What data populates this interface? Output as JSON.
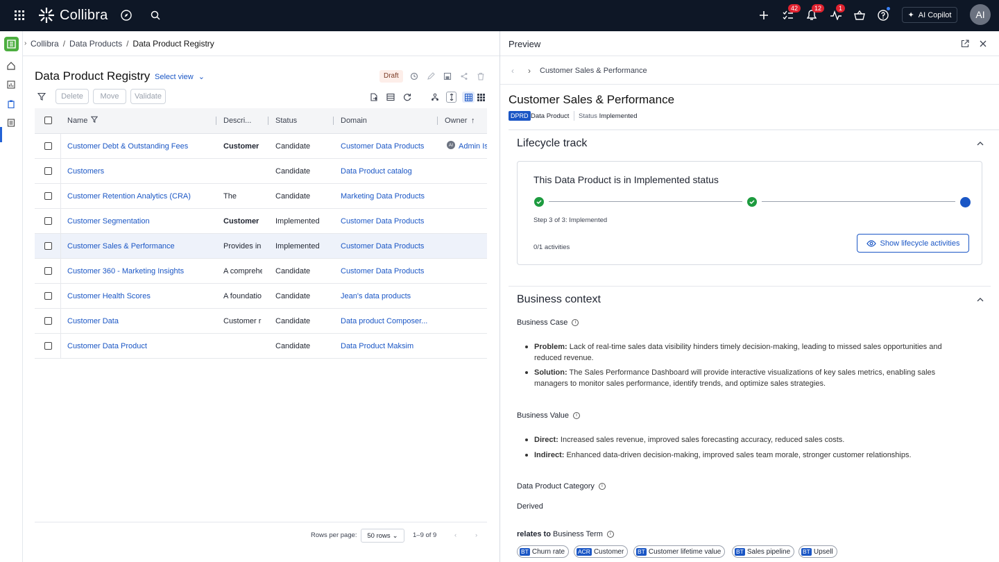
{
  "app": {
    "name": "Collibra"
  },
  "topbar": {
    "badges": {
      "tasks": "42",
      "notifications": "12",
      "activity": "1"
    },
    "copilot_label": "AI Copilot",
    "avatar_initials": "AI"
  },
  "breadcrumb": {
    "items": [
      "Collibra",
      "Data Products",
      "Data Product Registry"
    ],
    "separator": "/"
  },
  "registry": {
    "title": "Data Product Registry",
    "select_view": "Select view",
    "draft_label": "Draft",
    "actions": {
      "delete": "Delete",
      "move": "Move",
      "validate": "Validate"
    },
    "columns": {
      "name": "Name",
      "description": "Descri...",
      "status": "Status",
      "domain": "Domain",
      "owner": "Owner"
    },
    "rows": [
      {
        "name": "Customer Debt & Outstanding Fees",
        "description": "Customer",
        "desc_bold": true,
        "status": "Candidate",
        "domain": "Customer Data Products",
        "owner_initials": "AI",
        "owner": "Admin Is"
      },
      {
        "name": "Customers",
        "description": "",
        "status": "Candidate",
        "domain": "Data Product catalog",
        "owner": ""
      },
      {
        "name": "Customer Retention Analytics (CRA)",
        "description": "The",
        "status": "Candidate",
        "domain": "Marketing Data Products",
        "owner": ""
      },
      {
        "name": "Customer Segmentation",
        "description": "Customer",
        "desc_bold": true,
        "status": "Implemented",
        "domain": "Customer Data Products",
        "owner": ""
      },
      {
        "name": "Customer Sales & Performance",
        "description": "Provides in",
        "status": "Implemented",
        "domain": "Customer Data Products",
        "owner": "",
        "selected": true
      },
      {
        "name": "Customer 360 - Marketing Insights",
        "description": "A comprehe",
        "status": "Candidate",
        "domain": "Customer Data Products",
        "owner": ""
      },
      {
        "name": "Customer Health Scores",
        "description": "A foundatio",
        "status": "Candidate",
        "domain": "Jean's data products",
        "owner": ""
      },
      {
        "name": "Customer Data",
        "description": "Customer r",
        "status": "Candidate",
        "domain": "Data product Composer...",
        "owner": ""
      },
      {
        "name": "Customer Data Product",
        "description": "",
        "status": "Candidate",
        "domain": "Data Product Maksim",
        "owner": ""
      }
    ],
    "footer": {
      "rows_per_page_label": "Rows per page:",
      "rows_per_page_value": "50 rows",
      "range": "1–9 of 9"
    }
  },
  "preview": {
    "header": "Preview",
    "crumb": "Customer Sales & Performance",
    "name": "Customer Sales & Performance",
    "type_tag": "DPRD",
    "type_label": "Data Product",
    "status_label": "Status",
    "status_value": "Implemented",
    "lifecycle": {
      "section_title": "Lifecycle track",
      "headline": "This Data Product is in Implemented status",
      "step_text": "Step 3 of 3: Implemented",
      "activities": "0/1 activities",
      "button": "Show lifecycle activities",
      "current_step": 3,
      "total_steps": 3
    },
    "business_context": {
      "section_title": "Business context",
      "business_case_label": "Business Case",
      "business_case": [
        {
          "lead": "Problem:",
          "text": "Lack of real-time sales data visibility hinders timely decision-making, leading to missed sales opportunities and reduced revenue."
        },
        {
          "lead": "Solution:",
          "text": "The Sales Performance Dashboard will provide interactive visualizations of key sales metrics, enabling sales managers to monitor sales performance, identify trends, and optimize sales strategies."
        }
      ],
      "business_value_label": "Business Value",
      "business_value": [
        {
          "lead": "Direct:",
          "text": "Increased sales revenue, improved sales forecasting accuracy, reduced sales costs."
        },
        {
          "lead": "Indirect:",
          "text": "Enhanced data-driven decision-making, improved sales team morale, stronger customer relationships."
        }
      ],
      "category_label": "Data Product Category",
      "category_value": "Derived",
      "relates_label": "relates to",
      "relates_suffix": "Business Term",
      "terms": [
        {
          "tag": "BT",
          "label": "Churn rate"
        },
        {
          "tag": "ACR",
          "label": "Customer"
        },
        {
          "tag": "BT",
          "label": "Customer lifetime value"
        },
        {
          "tag": "BT",
          "label": "Sales pipeline"
        },
        {
          "tag": "BT",
          "label": "Upsell"
        }
      ]
    }
  },
  "colors": {
    "topbar": "#0e1726",
    "accent": "#1a56c5",
    "success": "#1d9b3f",
    "badge": "#e0222f"
  }
}
